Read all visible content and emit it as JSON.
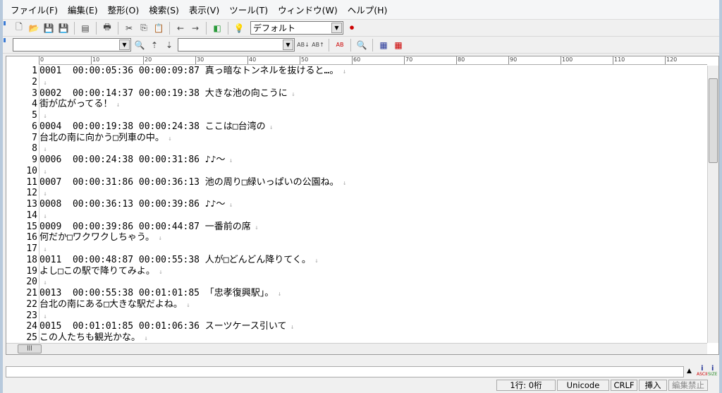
{
  "menu": [
    "ファイル(F)",
    "編集(E)",
    "整形(O)",
    "検索(S)",
    "表示(V)",
    "ツール(T)",
    "ウィンドウ(W)",
    "ヘルプ(H)"
  ],
  "toolbar": {
    "font_combo": "デフォルト"
  },
  "search": {
    "find_value": "",
    "replace_value": ""
  },
  "ruler_ticks": [
    "0",
    "10",
    "20",
    "30",
    "40",
    "50",
    "60",
    "70",
    "80",
    "90",
    "100",
    "110",
    "120"
  ],
  "lines": [
    "0001  00:00:05:36 00:00:09:87 真っ暗なトンネルを抜けると…。",
    "",
    "0002  00:00:14:37 00:00:19:38 大きな池の向こうに",
    "街が広がってる！",
    "",
    "0004  00:00:19:38 00:00:24:38 ここは□台湾の",
    "台北の南に向かう□列車の中。",
    "",
    "0006  00:00:24:38 00:00:31:86 ♪♪～",
    "",
    "0007  00:00:31:86 00:00:36:13 池の周り□緑いっぱいの公園ね。",
    "",
    "0008  00:00:36:13 00:00:39:86 ♪♪～",
    "",
    "0009  00:00:39:86 00:00:44:87 一番前の席",
    "何だか□ワクワクしちゃう。",
    "",
    "0011  00:00:48:87 00:00:55:38 人が□どんどん降りてく。",
    "よし□この駅で降りてみよ。",
    "",
    "0013  00:00:55:38 00:01:01:85 「忠孝復興駅」。",
    "台北の南にある□大きな駅だよね。",
    "",
    "0015  00:01:01:85 00:01:06:36 スーツケース引いて",
    "この人たちも観光かな。",
    ""
  ],
  "status": {
    "position": "1行: 0桁",
    "encoding": "Unicode",
    "eol": "CRLF",
    "mode": "挿入",
    "readonly": "編集禁止",
    "ascii_label": "ASCII",
    "size_label": "SIZE"
  }
}
